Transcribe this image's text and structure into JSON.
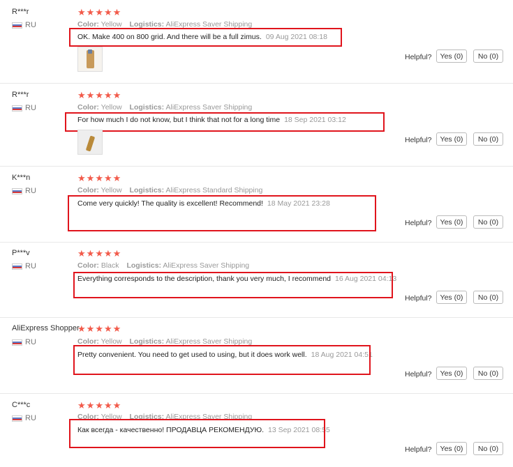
{
  "labels": {
    "color": "Color:",
    "logistics": "Logistics:",
    "helpful": "Helpful?",
    "yes": "Yes (0)",
    "no": "No (0)",
    "star": "★"
  },
  "colors": {
    "star": "#f25a4a",
    "highlight": "#e0141c"
  },
  "reviews": [
    {
      "user": "R***r",
      "country": "RU",
      "rating": 5,
      "color": "Yellow",
      "logistics": "AliExpress Saver Shipping",
      "text": "OK. Make 400 on 800 grid. And there will be a full zimus.",
      "date": "09 Aug 2021 08:18",
      "has_photo": true
    },
    {
      "user": "R***r",
      "country": "RU",
      "rating": 5,
      "color": "Yellow",
      "logistics": "AliExpress Saver Shipping",
      "text": "For how much I do not know, but I think that not for a long time",
      "date": "18 Sep 2021 03:12",
      "has_photo": true
    },
    {
      "user": "K***n",
      "country": "RU",
      "rating": 5,
      "color": "Yellow",
      "logistics": "AliExpress Standard Shipping",
      "text": "Come very quickly! The quality is excellent! Recommend!",
      "date": "18 May 2021 23:28",
      "has_photo": false
    },
    {
      "user": "P***v",
      "country": "RU",
      "rating": 5,
      "color": "Black",
      "logistics": "AliExpress Saver Shipping",
      "text": "Everything corresponds to the description, thank you very much, I recommend",
      "date": "16 Aug 2021 04:13",
      "has_photo": false
    },
    {
      "user": "AliExpress Shopper",
      "country": "RU",
      "rating": 5,
      "color": "Yellow",
      "logistics": "AliExpress Saver Shipping",
      "text": "Pretty convenient. You need to get used to using, but it does work well.",
      "date": "18 Aug 2021 04:51",
      "has_photo": false
    },
    {
      "user": "C***c",
      "country": "RU",
      "rating": 5,
      "color": "Yellow",
      "logistics": "AliExpress Saver Shipping",
      "text": "Как всегда - качественно! ПРОДАВЦА РЕКОМЕНДУЮ.",
      "date": "13 Sep 2021 08:55",
      "has_photo": false
    }
  ]
}
